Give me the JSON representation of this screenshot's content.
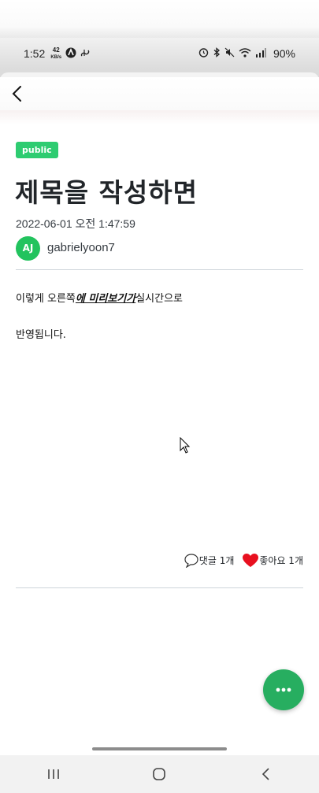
{
  "status_bar": {
    "time": "1:52",
    "net_speed_value": "42",
    "net_speed_unit": "KB/s",
    "battery": "90%"
  },
  "post": {
    "visibility": "public",
    "title": "제목을 작성하면",
    "datetime": "2022-06-01 오전 1:47:59",
    "author_initials": "AJ",
    "author": "gabrielyoon7",
    "body_line1_pre": "이렇게 오른쪽",
    "body_line1_emph": "에 미리보기가",
    "body_line1_post": "실시간으로",
    "body_line2": "반영됩니다."
  },
  "actions": {
    "comments_label": "댓글 1개",
    "likes_label": "좋아요 1개"
  },
  "colors": {
    "accent_green": "#27ae60",
    "badge_green": "#2ecc71",
    "like_red": "#e8101f"
  }
}
